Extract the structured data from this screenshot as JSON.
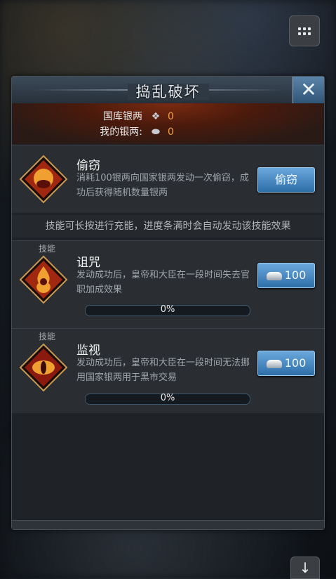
{
  "title": "捣乱破坏",
  "treasury": {
    "national_label": "国库银两",
    "national_value": "0",
    "mine_label": "我的银两:",
    "mine_value": "0"
  },
  "steal": {
    "name": "偷窃",
    "desc": "消耗100银两向国家银两发动一次偷窃，成功后获得随机数量银两",
    "button": "偷窃"
  },
  "tip": "技能可长按进行充能，进度条满时会自动发动该技能效果",
  "skills": [
    {
      "tag": "技能",
      "name": "诅咒",
      "desc": "发动成功后，皇帝和大臣在一段时间失去官职加成效果",
      "cost": "100",
      "progress_text": "0%",
      "progress": 0
    },
    {
      "tag": "技能",
      "name": "监视",
      "desc": "发动成功后，皇帝和大臣在一段时间无法挪用国家银两用于黑市交易",
      "cost": "100",
      "progress_text": "0%",
      "progress": 0
    }
  ],
  "icons": {
    "menu": "grid-menu-icon",
    "close": "close-icon",
    "down": "arrow-down-icon",
    "silver": "silver-ingot-icon",
    "crystal": "crystal-icon"
  },
  "colors": {
    "accent": "#3a8ad0",
    "value": "#f0a040"
  }
}
